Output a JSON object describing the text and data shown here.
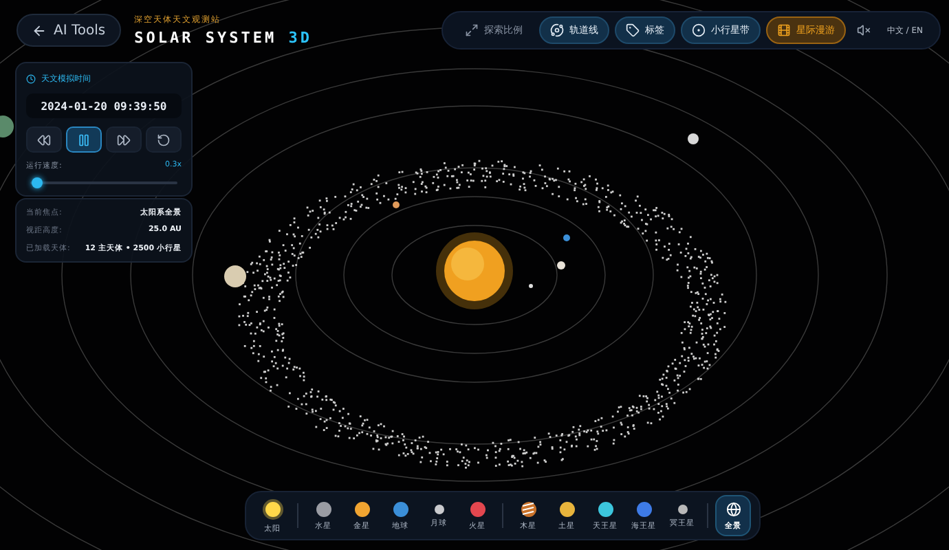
{
  "header": {
    "back_button": "AI Tools",
    "subtitle": "深空天体天文观测站",
    "title": "SOLAR SYSTEM",
    "title_accent": "3D"
  },
  "toolbar": {
    "items": [
      {
        "label": "探索比例",
        "kind": "plain",
        "on": false
      },
      {
        "label": "轨道线",
        "kind": "toggle",
        "on": true
      },
      {
        "label": "标签",
        "kind": "toggle",
        "on": true
      },
      {
        "label": "小行星带",
        "kind": "toggle",
        "on": true
      },
      {
        "label": "星际漫游",
        "kind": "highlight",
        "on": true
      }
    ],
    "muted": true,
    "language": "中文 / EN"
  },
  "time_panel": {
    "title": "天文模拟时间",
    "datetime": "2024-01-20 09:39:50",
    "playing": true,
    "speed_label": "运行速度:",
    "speed_value": "0.3x",
    "level": 0.05
  },
  "info_panel": {
    "rows": [
      {
        "label": "当前焦点:",
        "value": "太阳系全景"
      },
      {
        "label": "视距高度:",
        "value": "25.0 AU"
      },
      {
        "label": "已加载天体:",
        "value": "12 主天体 • 2500 小行星"
      }
    ]
  },
  "dock": {
    "items": [
      {
        "label": "太阳",
        "kind": "glow",
        "color": "#ffd84a",
        "divider_before": false,
        "selected": false
      },
      {
        "label": "水星",
        "kind": "plain",
        "color": "#9a9ca3",
        "divider_before": true,
        "selected": false
      },
      {
        "label": "金星",
        "kind": "plain",
        "color": "#f0a431",
        "divider_before": false,
        "selected": false
      },
      {
        "label": "地球",
        "kind": "plain",
        "color": "#3b8fd8",
        "divider_before": false,
        "selected": false
      },
      {
        "label": "月球",
        "kind": "small",
        "color": "#c9cacd",
        "divider_before": false,
        "selected": false
      },
      {
        "label": "火星",
        "kind": "plain",
        "color": "#e3474f",
        "divider_before": false,
        "selected": false
      },
      {
        "label": "木星",
        "kind": "striped",
        "color": "#c9722a",
        "divider_before": true,
        "selected": false
      },
      {
        "label": "土星",
        "kind": "plain",
        "color": "#e8b43c",
        "divider_before": false,
        "selected": false
      },
      {
        "label": "天王星",
        "kind": "plain",
        "color": "#3cc6dd",
        "divider_before": false,
        "selected": false
      },
      {
        "label": "海王星",
        "kind": "plain",
        "color": "#3e7be6",
        "divider_before": false,
        "selected": false
      },
      {
        "label": "冥王星",
        "kind": "small",
        "color": "#b8b8b8",
        "divider_before": false,
        "selected": false
      },
      {
        "label": "全景",
        "kind": "globe",
        "color": "#ffffff",
        "divider_before": true,
        "selected": true
      }
    ]
  }
}
